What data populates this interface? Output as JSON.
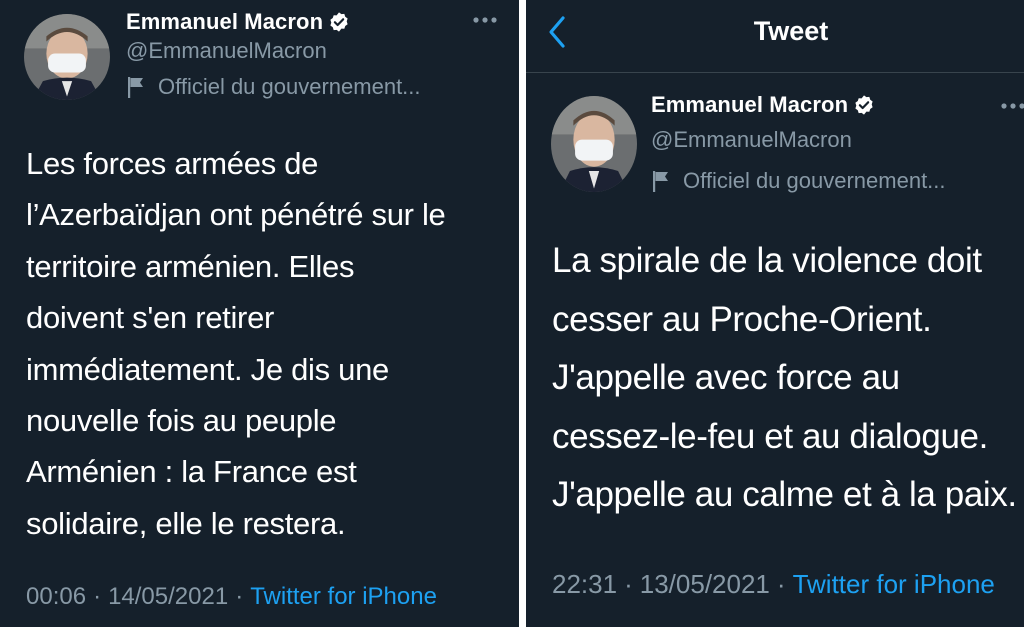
{
  "colors": {
    "background": "#15202b",
    "primary_text": "#ffffff",
    "secondary_text": "#8899a6",
    "accent": "#1da1f2",
    "divider": "#38444d"
  },
  "left_tweet": {
    "author": {
      "display_name": "Emmanuel Macron",
      "handle": "@EmmanuelMacron",
      "label": "Officiel du gouvernement...",
      "verified_icon": "verified-badge-icon",
      "label_icon": "flag-icon"
    },
    "more_icon": "more-horizontal-icon",
    "text_lines": [
      "Les forces armées de",
      "l’Azerbaïdjan ont pénétré sur le",
      "territoire arménien. Elles",
      "doivent s'en retirer",
      "immédiatement. Je dis une",
      "nouvelle fois au peuple",
      "Arménien : la France est",
      "solidaire, elle le restera."
    ],
    "time": "00:06",
    "date": "14/05/2021",
    "separator": "·",
    "source": "Twitter for iPhone"
  },
  "right_tweet": {
    "header": {
      "title": "Tweet",
      "back_icon": "chevron-left-icon"
    },
    "author": {
      "display_name": "Emmanuel Macron",
      "handle": "@EmmanuelMacron",
      "label": "Officiel du gouvernement...",
      "verified_icon": "verified-badge-icon",
      "label_icon": "flag-icon"
    },
    "more_icon": "more-horizontal-icon",
    "text_lines": [
      "La spirale de la violence doit",
      "cesser au Proche-Orient.",
      "J'appelle avec force au",
      "cessez-le-feu et au dialogue.",
      "J'appelle au calme et à la paix."
    ],
    "time": "22:31",
    "date": "13/05/2021",
    "separator": "·",
    "source": "Twitter for iPhone"
  }
}
